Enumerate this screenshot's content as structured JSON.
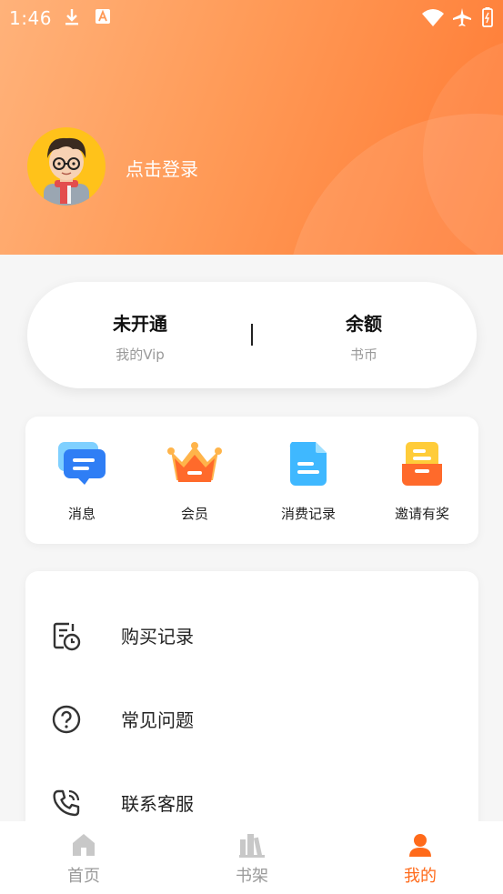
{
  "status_bar": {
    "time": "1:46",
    "left_icons": [
      "download-icon",
      "font-a-icon"
    ],
    "right_icons": [
      "wifi-icon",
      "airplane-icon",
      "battery-icon"
    ]
  },
  "header": {
    "login_prompt": "点击登录",
    "avatar": "cartoon-boy-avatar"
  },
  "vip_card": {
    "vip_status": "未开通",
    "vip_label": "我的Vip",
    "balance_title": "余额",
    "balance_label": "书币"
  },
  "quick_actions": [
    {
      "label": "消息",
      "icon": "message-icon"
    },
    {
      "label": "会员",
      "icon": "crown-icon"
    },
    {
      "label": "消费记录",
      "icon": "document-icon"
    },
    {
      "label": "邀请有奖",
      "icon": "gift-box-icon"
    }
  ],
  "menu": [
    {
      "label": "购买记录",
      "icon": "purchase-history-icon"
    },
    {
      "label": "常见问题",
      "icon": "question-icon"
    },
    {
      "label": "联系客服",
      "icon": "phone-call-icon"
    }
  ],
  "tab_bar": [
    {
      "label": "首页",
      "icon": "home-icon"
    },
    {
      "label": "书架",
      "icon": "bookshelf-icon"
    },
    {
      "label": "我的",
      "icon": "profile-icon"
    }
  ],
  "colors": {
    "accent": "#ff6a1a",
    "header_gradient_start": "#ffb27a",
    "header_gradient_end": "#ff7a33",
    "tab_inactive": "#9a9a9a"
  }
}
